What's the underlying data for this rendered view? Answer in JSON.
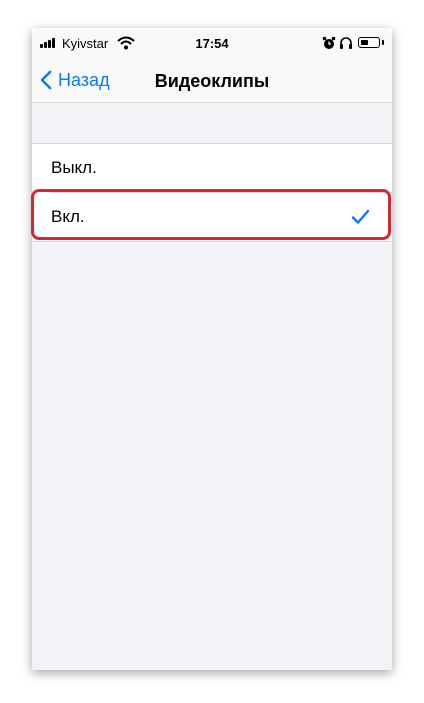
{
  "status_bar": {
    "carrier": "Kyivstar",
    "time": "17:54"
  },
  "nav": {
    "back_label": "Назад",
    "title": "Видеоклипы"
  },
  "options": [
    {
      "label": "Выкл.",
      "selected": false
    },
    {
      "label": "Вкл.",
      "selected": true
    }
  ],
  "colors": {
    "accent": "#0a7aff",
    "highlight": "#d9262e",
    "background": "#f2f2f7"
  }
}
